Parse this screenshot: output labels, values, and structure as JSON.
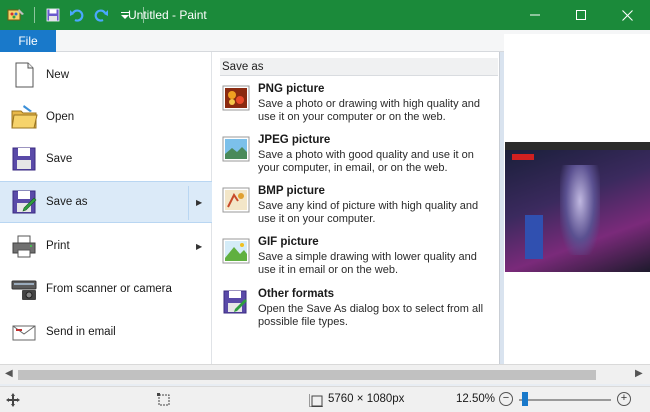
{
  "window": {
    "title": "Untitled - Paint",
    "accent_color": "#1b8a3a",
    "minimize_icon": "minimize-icon",
    "maximize_icon": "maximize-icon",
    "close_icon": "close-icon"
  },
  "quick_access": {
    "app_icon": "paint-app-icon",
    "save_icon": "save-icon",
    "undo_icon": "undo-icon",
    "redo_icon": "redo-icon",
    "customize_icon": "dropdown-arrow-icon"
  },
  "ribbon": {
    "file_tab_label": "File",
    "file_tab_color": "#1979ca"
  },
  "file_menu": {
    "items": [
      {
        "label": "New",
        "icon": "new-file-icon"
      },
      {
        "label": "Open",
        "icon": "open-folder-icon"
      },
      {
        "label": "Save",
        "icon": "save-disk-icon"
      },
      {
        "label": "Save as",
        "icon": "save-as-icon",
        "selected": true,
        "has_submenu": true
      },
      {
        "label": "Print",
        "icon": "printer-icon",
        "has_submenu": true
      },
      {
        "label": "From scanner or camera",
        "icon": "scanner-icon"
      },
      {
        "label": "Send in email",
        "icon": "email-icon"
      }
    ]
  },
  "save_as": {
    "header": "Save as",
    "options": [
      {
        "title": "PNG picture",
        "desc": "Save a photo or drawing with high quality and use it on your computer or on the web.",
        "icon": "png-picture-icon"
      },
      {
        "title": "JPEG picture",
        "desc": "Save a photo with good quality and use it on your computer, in email, or on the web.",
        "icon": "jpeg-picture-icon"
      },
      {
        "title": "BMP picture",
        "desc": "Save any kind of picture with high quality and use it on your computer.",
        "icon": "bmp-picture-icon"
      },
      {
        "title": "GIF picture",
        "desc": "Save a simple drawing with lower quality and use it in email or on the web.",
        "icon": "gif-picture-icon"
      },
      {
        "title": "Other formats",
        "desc": "Open the Save As dialog box to select from all possible file types.",
        "icon": "other-formats-icon"
      }
    ]
  },
  "status_bar": {
    "move_icon": "move-cursor-icon",
    "selection_icon": "selection-size-icon",
    "image_size_icon": "image-size-icon",
    "image_size": "5760 × 1080px",
    "zoom_level": "12.50%",
    "zoom_fraction": 0.06
  }
}
